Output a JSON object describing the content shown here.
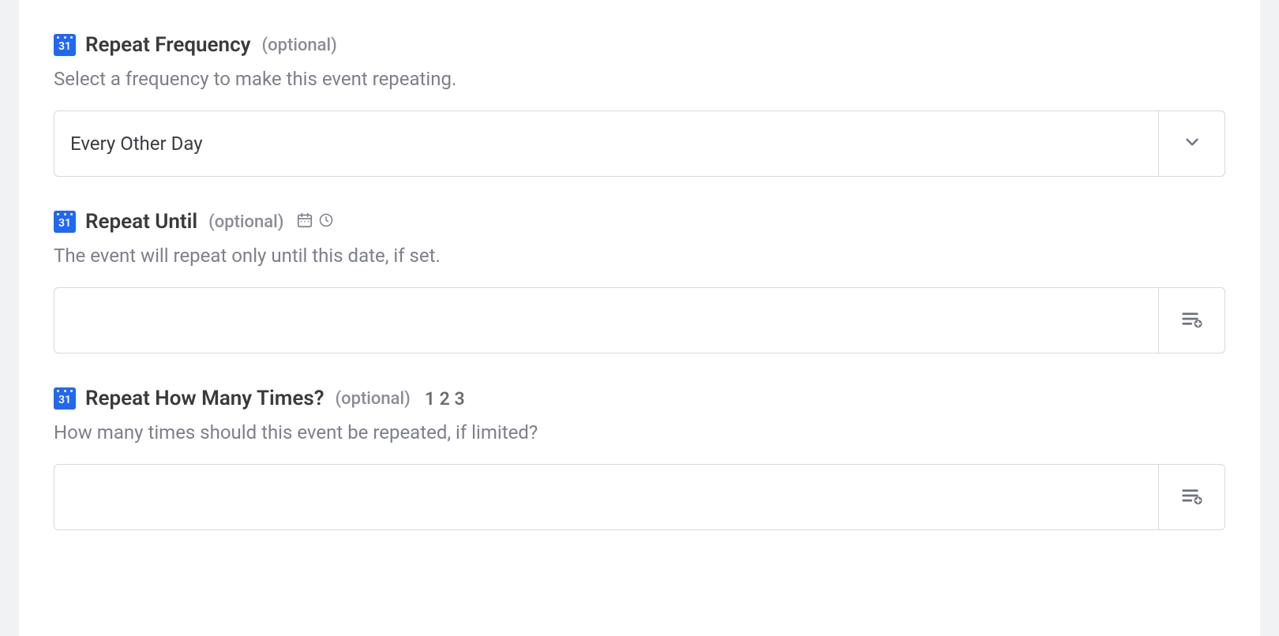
{
  "icon_day": "31",
  "optional_label": "(optional)",
  "hint_123": "1 2 3",
  "fields": {
    "repeat_frequency": {
      "label": "Repeat Frequency",
      "description": "Select a frequency to make this event repeating.",
      "value": "Every Other Day"
    },
    "repeat_until": {
      "label": "Repeat Until",
      "description": "The event will repeat only until this date, if set.",
      "value": ""
    },
    "repeat_count": {
      "label": "Repeat How Many Times?",
      "description": "How many times should this event be repeated, if limited?",
      "value": ""
    }
  }
}
